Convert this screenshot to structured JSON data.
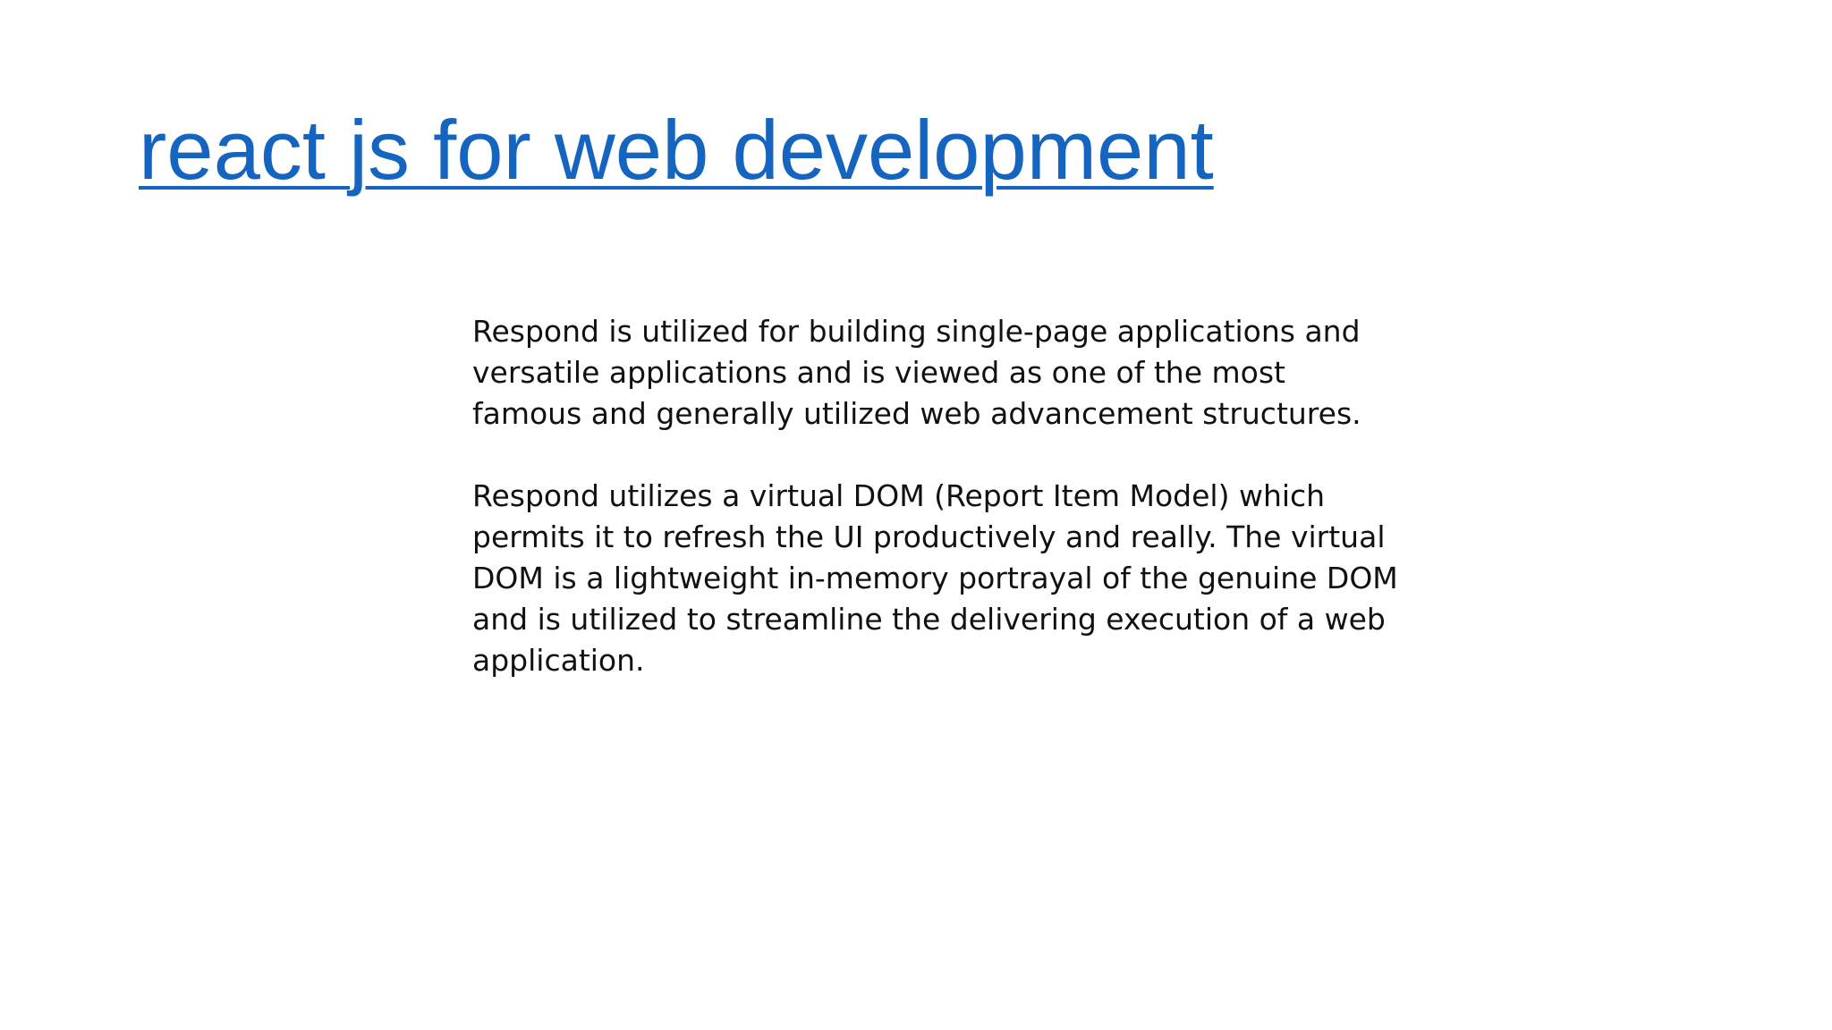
{
  "slide": {
    "title": "react js for web development",
    "paragraphs": [
      "Respond is utilized for building single-page applications and versatile applications and is viewed as one of the most famous and generally utilized web advancement structures.",
      "Respond utilizes a virtual DOM (Report Item Model) which permits it to refresh the UI productively and really. The virtual DOM is a lightweight in-memory portrayal of the genuine DOM and is utilized to streamline the delivering execution of a web application."
    ],
    "colors": {
      "title": "#1565c0",
      "text": "#111111",
      "background": "#ffffff"
    }
  }
}
